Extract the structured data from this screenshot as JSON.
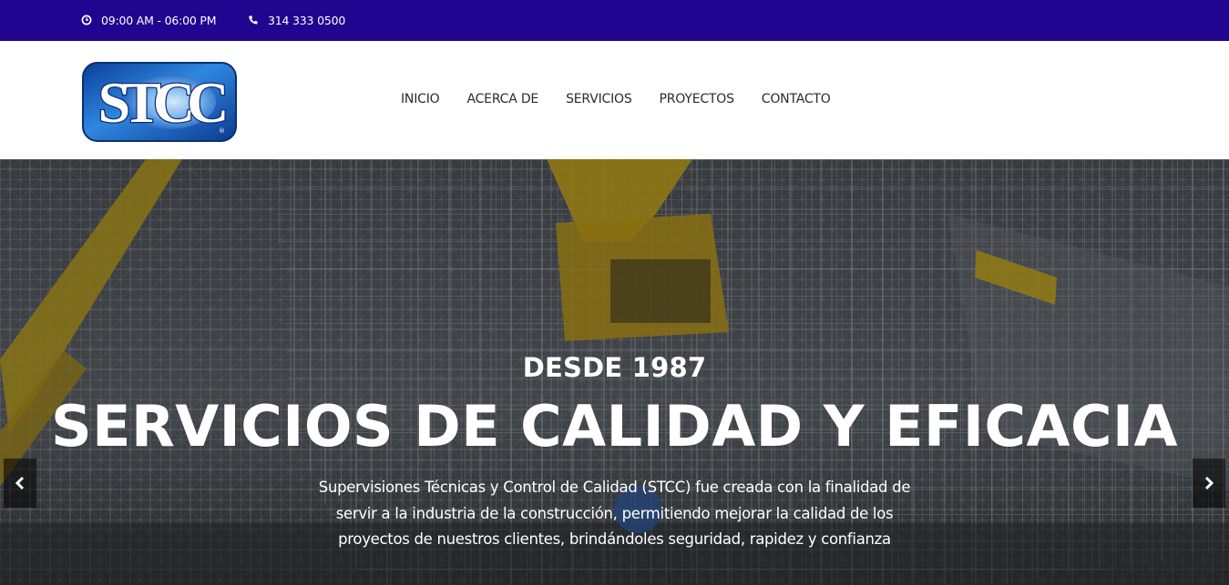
{
  "topbar": {
    "hours": "09:00 AM - 06:00 PM",
    "hours_icon": "clock-icon",
    "phone": "314 333 0500",
    "phone_icon": "phone-icon",
    "background": "#1f058f"
  },
  "logo": {
    "text": "STCC",
    "mark": "®",
    "colors": {
      "primary": "#0d4aa8",
      "light": "#3a8fe6",
      "border": "#0a2f73"
    }
  },
  "nav": {
    "items": [
      {
        "label": "INICIO"
      },
      {
        "label": "ACERCA DE"
      },
      {
        "label": "SERVICIOS"
      },
      {
        "label": "PROYECTOS"
      },
      {
        "label": "CONTACTO"
      }
    ]
  },
  "hero": {
    "kicker": "DESDE 1987",
    "headline": "SERVICIOS DE CALIDAD Y EFICACIA",
    "description": "Supervisiones Técnicas y Control de Calidad (STCC) fue creada con la finalidad de servir a la industria de la construcción, permitiendo mejorar la calidad de los proyectos de nuestros clientes, brindándoles seguridad, rapidez y confianza",
    "prev_icon": "chevron-left-icon",
    "next_icon": "chevron-right-icon"
  }
}
